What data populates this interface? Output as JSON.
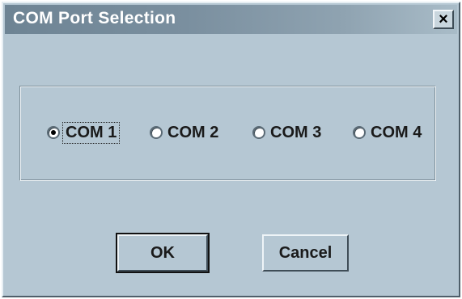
{
  "dialog": {
    "title": "COM Port Selection",
    "close_glyph": "×"
  },
  "ports": [
    {
      "label": "COM 1",
      "selected": true
    },
    {
      "label": "COM 2",
      "selected": false
    },
    {
      "label": "COM 3",
      "selected": false
    },
    {
      "label": "COM 4",
      "selected": false
    }
  ],
  "buttons": {
    "ok_label": "OK",
    "cancel_label": "Cancel"
  },
  "colors": {
    "face": "#b5c7d3",
    "title_start": "#6e8494",
    "title_end": "#a9bcc8"
  }
}
